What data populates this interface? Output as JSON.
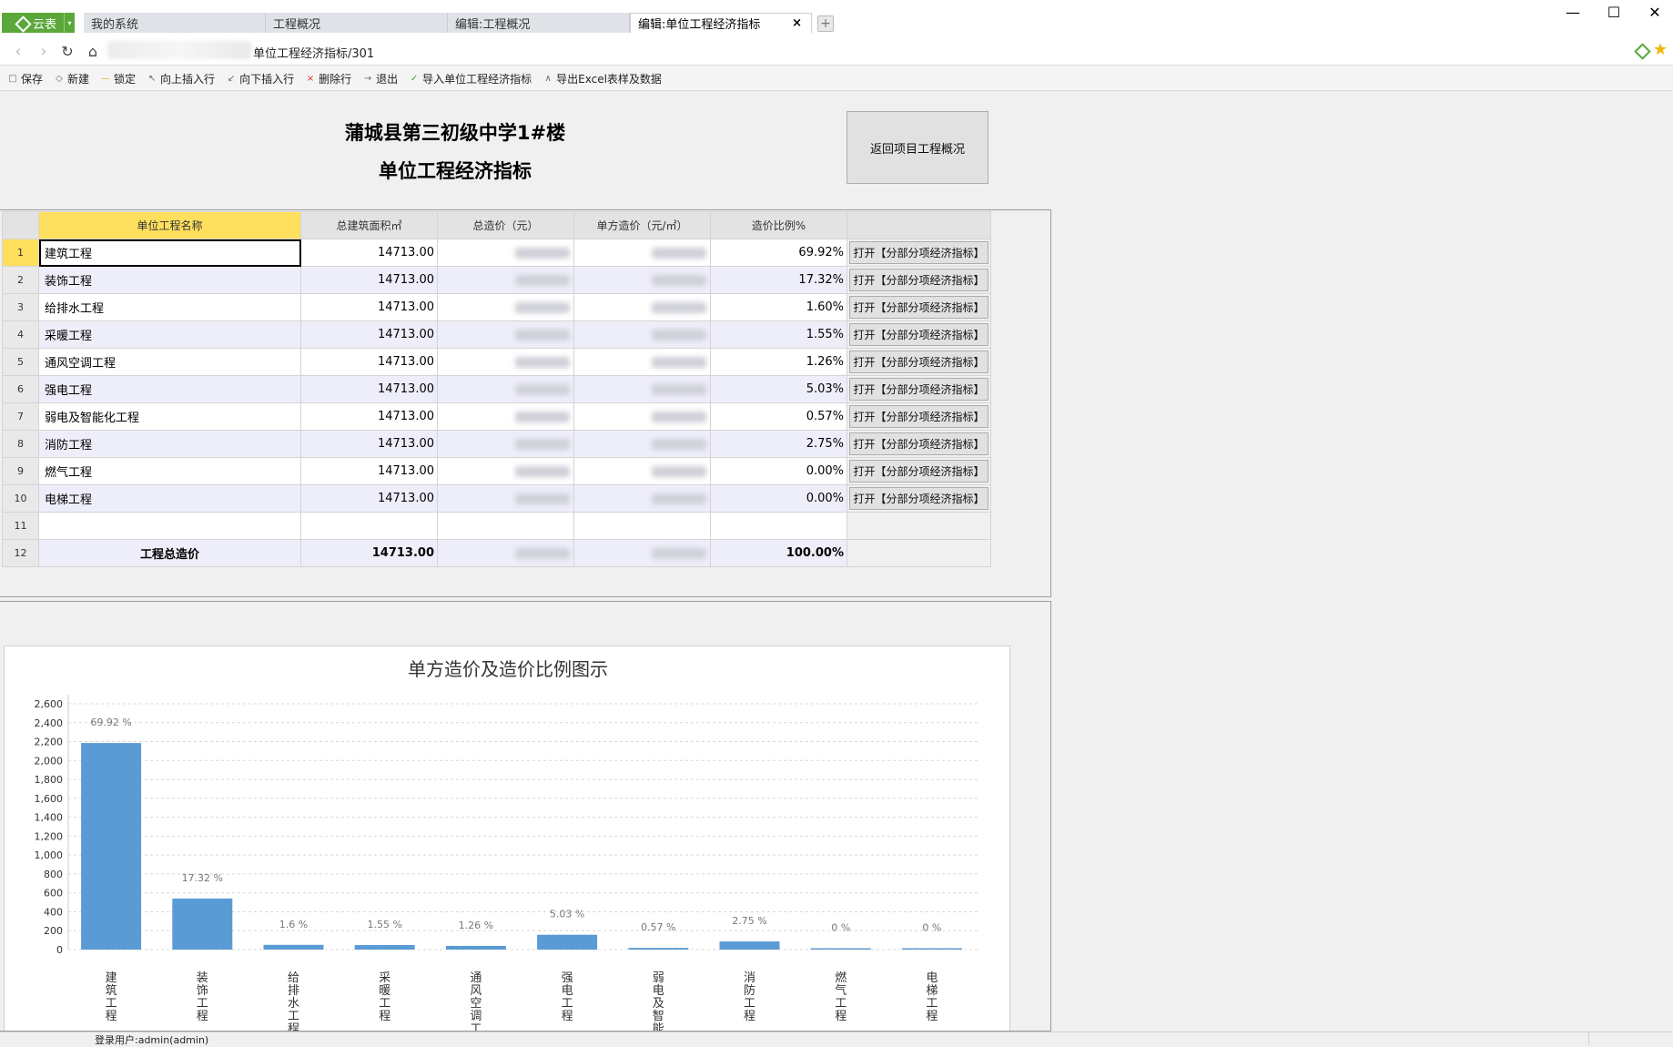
{
  "app": {
    "label": "云表"
  },
  "tabs": [
    {
      "label": "我的系统"
    },
    {
      "label": "工程概况"
    },
    {
      "label": "编辑:工程概况"
    },
    {
      "label": "编辑:单位工程经济指标",
      "close": "×"
    }
  ],
  "address": {
    "url_suffix": "单位工程经济指标/301"
  },
  "toolbar": [
    {
      "label": "保存",
      "icon": "□"
    },
    {
      "label": "新建",
      "icon": "◇"
    },
    {
      "label": "锁定",
      "icon": "—"
    },
    {
      "label": "向上插入行",
      "icon": "↖"
    },
    {
      "label": "向下插入行",
      "icon": "↙"
    },
    {
      "label": "删除行",
      "icon": "×"
    },
    {
      "label": "退出",
      "icon": "→"
    },
    {
      "label": "导入单位工程经济指标",
      "icon": "✓"
    },
    {
      "label": "导出Excel表样及数据",
      "icon": "∧"
    }
  ],
  "sheet": {
    "title_line1": "蒲城县第三初级中学1#楼",
    "title_line2": "单位工程经济指标",
    "back_button": "返回项目工程概况",
    "headers": [
      "单位工程名称",
      "总建筑面积㎡",
      "总造价（元）",
      "单方造价（元/㎡）",
      "造价比例%"
    ],
    "open_label": "打开【分部分项经济指标】",
    "rows": [
      {
        "n": "1",
        "name": "建筑工程",
        "area": "14713.00",
        "ratio": "69.92%"
      },
      {
        "n": "2",
        "name": "装饰工程",
        "area": "14713.00",
        "ratio": "17.32%"
      },
      {
        "n": "3",
        "name": "给排水工程",
        "area": "14713.00",
        "ratio": "1.60%"
      },
      {
        "n": "4",
        "name": "采暖工程",
        "area": "14713.00",
        "ratio": "1.55%"
      },
      {
        "n": "5",
        "name": "通风空调工程",
        "area": "14713.00",
        "ratio": "1.26%"
      },
      {
        "n": "6",
        "name": "强电工程",
        "area": "14713.00",
        "ratio": "5.03%"
      },
      {
        "n": "7",
        "name": "弱电及智能化工程",
        "area": "14713.00",
        "ratio": "0.57%"
      },
      {
        "n": "8",
        "name": "消防工程",
        "area": "14713.00",
        "ratio": "2.75%"
      },
      {
        "n": "9",
        "name": "燃气工程",
        "area": "14713.00",
        "ratio": "0.00%"
      },
      {
        "n": "10",
        "name": "电梯工程",
        "area": "14713.00",
        "ratio": "0.00%"
      }
    ],
    "empty_row_n": "11",
    "total": {
      "n": "12",
      "name": "工程总造价",
      "area": "14713.00",
      "ratio": "100.00%"
    }
  },
  "chart_data": {
    "type": "bar",
    "title": "单方造价及造价比例图示",
    "categories": [
      "建筑工程",
      "装饰工程",
      "给排水工程",
      "采暖工程",
      "通风空调工程",
      "强电工程",
      "弱电及智能化工程",
      "消防工程",
      "燃气工程",
      "电梯工程"
    ],
    "values": [
      2185,
      540,
      50,
      48,
      39,
      157,
      18,
      86,
      0,
      0
    ],
    "data_labels": [
      "69.92 %",
      "17.32 %",
      "1.6 %",
      "1.55 %",
      "1.26 %",
      "5.03 %",
      "0.57 %",
      "2.75 %",
      "0 %",
      "0 %"
    ],
    "yticks": [
      "0",
      "200",
      "400",
      "600",
      "800",
      "1,000",
      "1,200",
      "1,400",
      "1,600",
      "1,800",
      "2,000",
      "2,200",
      "2,400",
      "2,600"
    ],
    "ylim": [
      0,
      2600
    ],
    "grid": true,
    "bar_color": "#5b9bd5"
  },
  "status": {
    "user": "登录用户:admin(admin)"
  }
}
